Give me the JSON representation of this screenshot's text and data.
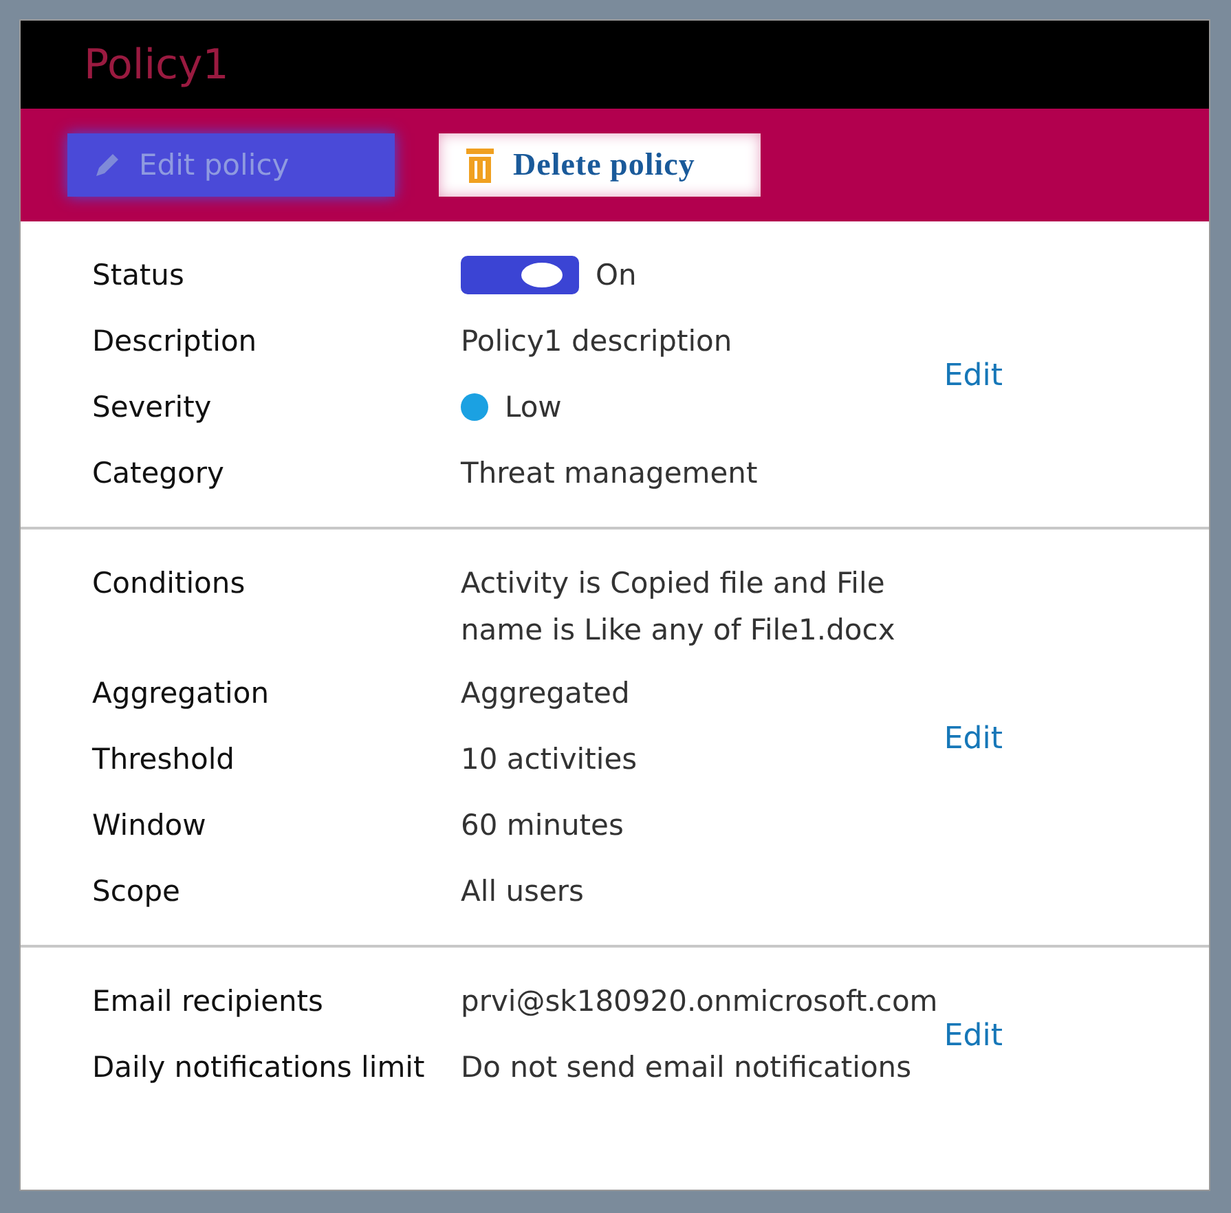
{
  "title": "Policy1",
  "actions": [
    {
      "label": "Edit policy",
      "kind": "edit"
    },
    {
      "label": "Delete policy",
      "kind": "delete"
    }
  ],
  "sections": [
    {
      "edit": "Edit",
      "rows": [
        {
          "label": "Status",
          "kind": "toggle",
          "on": true,
          "value": "On"
        },
        {
          "label": "Description",
          "kind": "text",
          "value": "Policy1 description"
        },
        {
          "label": "Severity",
          "kind": "severity",
          "color": "#1ba1e2",
          "value": "Low"
        },
        {
          "label": "Category",
          "kind": "text",
          "value": "Threat management"
        }
      ]
    },
    {
      "edit": "Edit",
      "rows": [
        {
          "label": "Conditions",
          "kind": "text",
          "value": "Activity is Copied file and File name is Like any of File1.docx"
        },
        {
          "label": "Aggregation",
          "kind": "text",
          "value": "Aggregated"
        },
        {
          "label": "Threshold",
          "kind": "text",
          "value": "10 activities"
        },
        {
          "label": "Window",
          "kind": "text",
          "value": "60 minutes"
        },
        {
          "label": "Scope",
          "kind": "text",
          "value": "All users"
        }
      ]
    },
    {
      "edit": "Edit",
      "rows": [
        {
          "label": "Email recipients",
          "kind": "text",
          "value": "prvi@sk180920.onmicrosoft.com"
        },
        {
          "label": "Daily notifications limit",
          "kind": "text",
          "value": "Do not send email notifications"
        }
      ]
    }
  ]
}
